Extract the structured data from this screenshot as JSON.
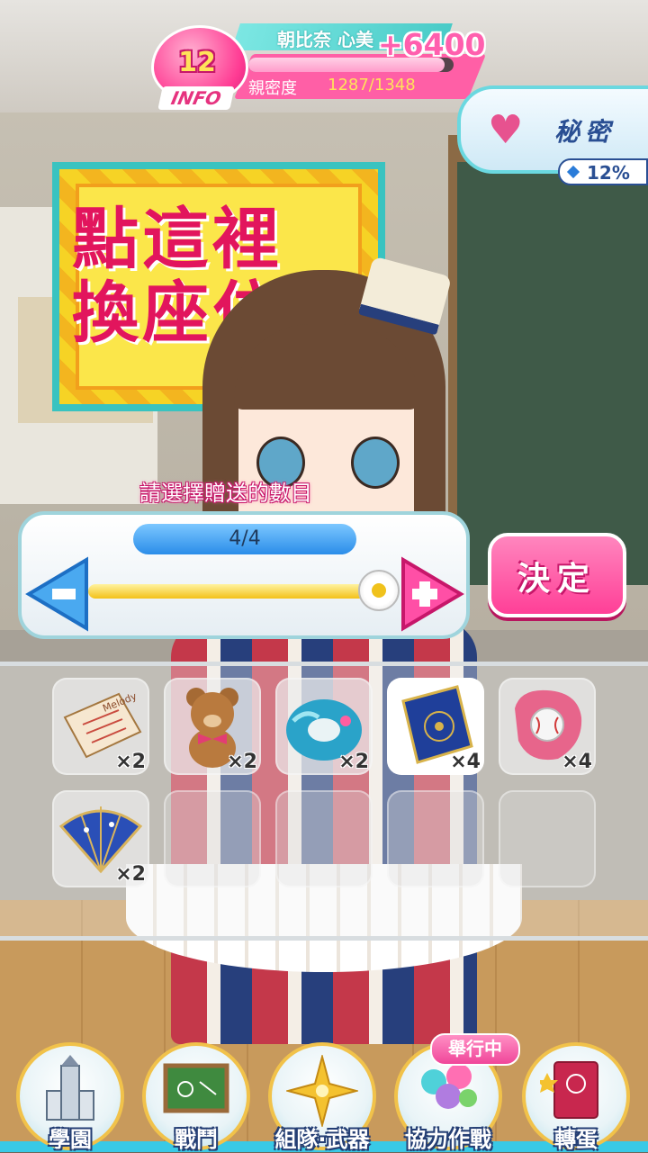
{
  "hud": {
    "level": "12",
    "info_label": "INFO",
    "character_name": "朝比奈 心美",
    "score_gain": "+6400",
    "affection_label": "親密度",
    "affection_value": "1287/1348",
    "affection_progress": 0.955,
    "secret_label": "秘密",
    "secret_percent": "12%"
  },
  "poster": {
    "line1": "點這裡",
    "line2": "換座位"
  },
  "quantity_selector": {
    "prompt": "請選擇贈送的數目",
    "value": "4/4",
    "slider_value": 1.0,
    "confirm_label": "決定"
  },
  "gifts": [
    {
      "icon": "music-sheet-icon",
      "count": "×2",
      "selected": false
    },
    {
      "icon": "teddy-bear-icon",
      "count": "×2",
      "selected": false
    },
    {
      "icon": "swim-ring-icon",
      "count": "×2",
      "selected": false
    },
    {
      "icon": "blue-book-icon",
      "count": "×4",
      "selected": true
    },
    {
      "icon": "baseball-glove-icon",
      "count": "×4",
      "selected": false
    },
    {
      "icon": "folding-fan-icon",
      "count": "×2",
      "selected": false
    }
  ],
  "nav": {
    "items": [
      {
        "label": "學園",
        "icon": "school-tower-icon"
      },
      {
        "label": "戰鬥",
        "icon": "chalkboard-icon"
      },
      {
        "label": "組隊·武器",
        "icon": "star-compass-icon"
      },
      {
        "label": "協力作戰",
        "icon": "balloons-icon"
      },
      {
        "label": "轉蛋",
        "icon": "gacha-book-icon"
      }
    ],
    "event_badge": "舉行中"
  },
  "colors": {
    "accent_pink": "#ff3f97",
    "accent_cyan": "#49cbc7",
    "navy": "#243e74"
  }
}
